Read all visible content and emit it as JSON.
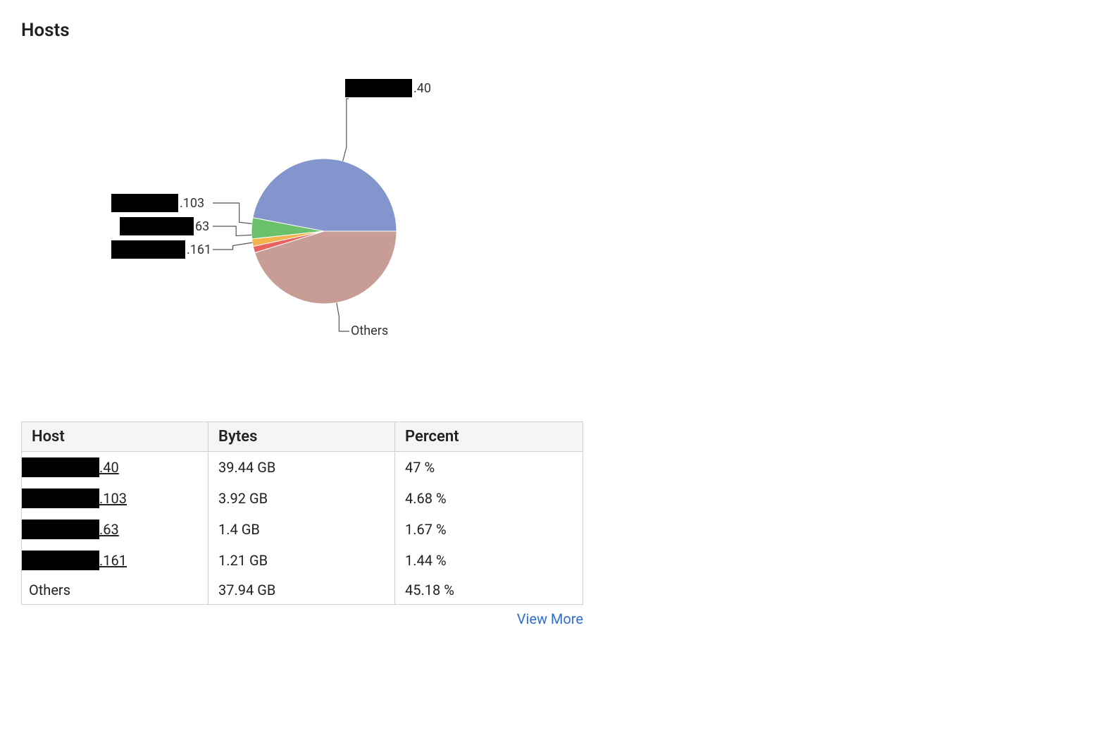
{
  "title": "Hosts",
  "chart_data": {
    "type": "pie",
    "title": "Hosts",
    "series": [
      {
        "name": "____.40",
        "label_suffix": ".40",
        "value": 47.0,
        "redacted": true,
        "color": "#8494cd"
      },
      {
        "name": "____.103",
        "label_suffix": ".103",
        "value": 4.68,
        "redacted": true,
        "color": "#6bc06b"
      },
      {
        "name": "____.63",
        "label_suffix": "63",
        "value": 1.67,
        "redacted": true,
        "color": "#f3b24b"
      },
      {
        "name": "____.161",
        "label_suffix": ".161",
        "value": 1.44,
        "redacted": true,
        "color": "#e86360"
      },
      {
        "name": "Others",
        "label_suffix": "Others",
        "value": 45.18,
        "redacted": false,
        "color": "#c79d96"
      }
    ]
  },
  "callouts": {
    "c0_suffix": ".40",
    "c1_suffix": ".103",
    "c2_suffix": "63",
    "c3_suffix": ".161",
    "c4_text": "Others"
  },
  "table": {
    "headers": {
      "host": "Host",
      "bytes": "Bytes",
      "percent": "Percent"
    },
    "rows": [
      {
        "host_suffix": ".40",
        "redacted": true,
        "bytes": "39.44 GB",
        "percent": "47 %"
      },
      {
        "host_suffix": ".103",
        "redacted": true,
        "bytes": "3.92 GB",
        "percent": "4.68 %"
      },
      {
        "host_suffix": ".63",
        "redacted": true,
        "bytes": "1.4 GB",
        "percent": "1.67 %"
      },
      {
        "host_suffix": ".161",
        "redacted": true,
        "bytes": "1.21 GB",
        "percent": "1.44 %"
      },
      {
        "host_suffix": "Others",
        "redacted": false,
        "bytes": "37.94 GB",
        "percent": "45.18 %"
      }
    ]
  },
  "view_more": "View More"
}
